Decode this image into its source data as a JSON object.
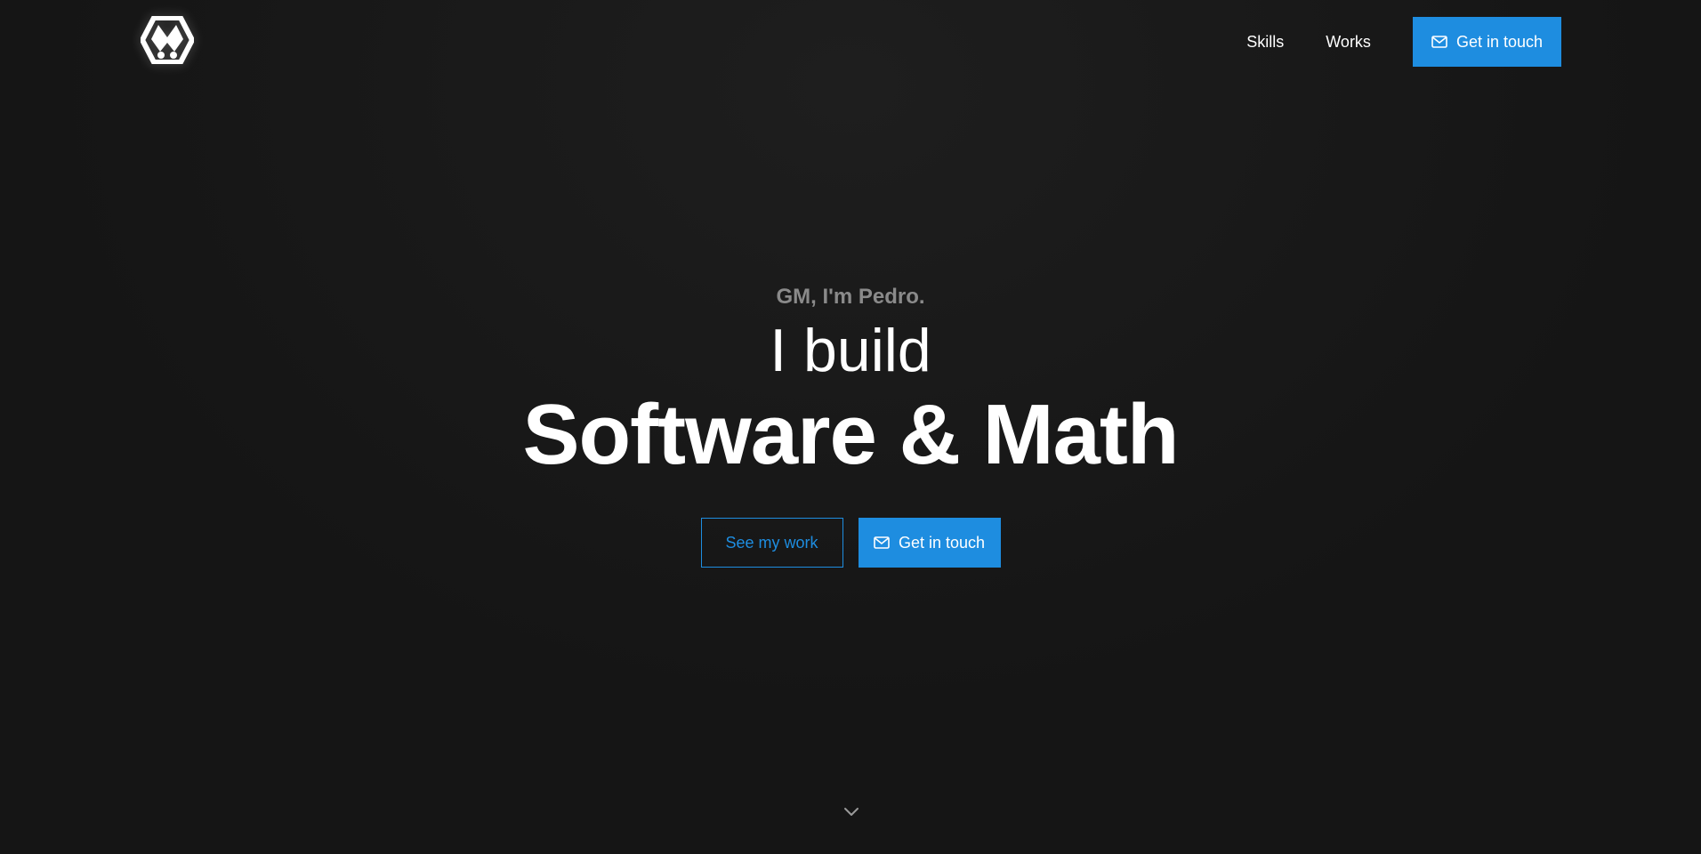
{
  "header": {
    "logo_icon": "bunny-hexagon-logo-icon",
    "nav": [
      {
        "label": "Skills"
      },
      {
        "label": "Works"
      }
    ],
    "cta_label": "Get in touch",
    "cta_icon": "mail-icon"
  },
  "hero": {
    "greeting": "GM, I'm Pedro.",
    "build_line": "I build",
    "headline": "Software & Math",
    "secondary_button": "See my work",
    "primary_button": "Get in touch",
    "scroll_icon": "chevron-down-icon"
  },
  "colors": {
    "accent": "#1e8de0",
    "background": "#161616",
    "muted_text": "#8a8a8a"
  }
}
